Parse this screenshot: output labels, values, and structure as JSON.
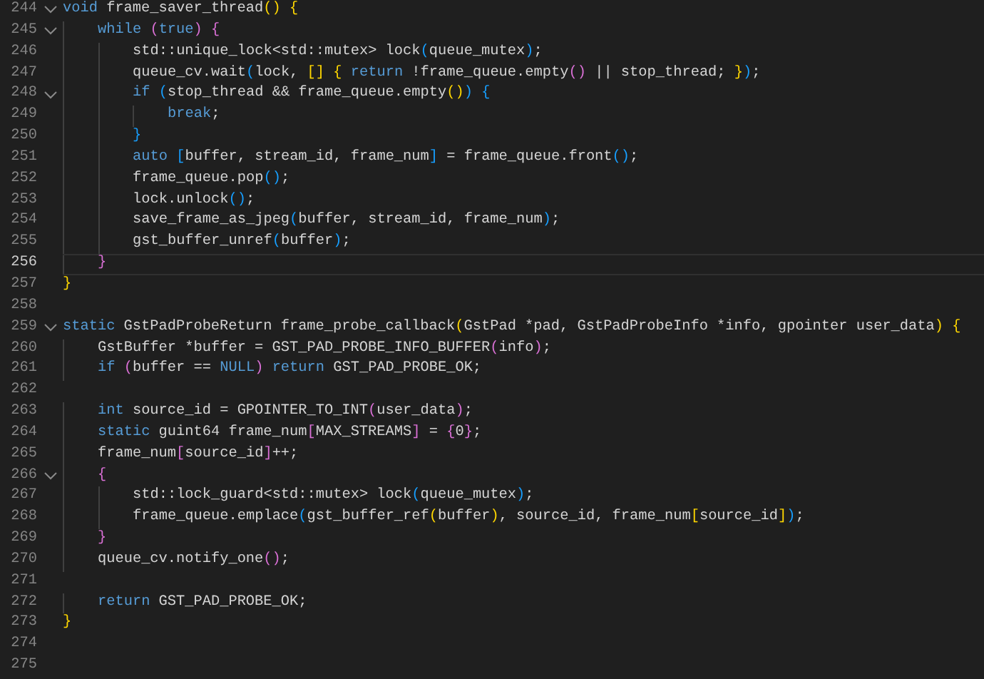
{
  "editor": {
    "lines": [
      {
        "number": "244",
        "fold": true,
        "selected": false,
        "tokens": [
          {
            "text": "void",
            "kind": "keyword"
          },
          {
            "text": " frame_saver_thread",
            "kind": "plain"
          },
          {
            "text": "()",
            "kind": "bracket1"
          },
          {
            "text": " {",
            "kind": "bracket1"
          }
        ]
      },
      {
        "number": "245",
        "fold": true,
        "selected": false,
        "tokens": [
          {
            "text": "    while",
            "kind": "keyword"
          },
          {
            "text": " (",
            "kind": "bracket2"
          },
          {
            "text": "true",
            "kind": "keyword"
          },
          {
            "text": ")",
            "kind": "bracket2"
          },
          {
            "text": " {",
            "kind": "bracket2"
          }
        ]
      },
      {
        "number": "246",
        "fold": false,
        "selected": false,
        "tokens": [
          {
            "text": "        std::unique_lock<std::mutex> lock",
            "kind": "plain"
          },
          {
            "text": "(",
            "kind": "bracket3"
          },
          {
            "text": "queue_mutex",
            "kind": "plain"
          },
          {
            "text": ")",
            "kind": "bracket3"
          },
          {
            "text": ";",
            "kind": "plain"
          }
        ]
      },
      {
        "number": "247",
        "fold": false,
        "selected": false,
        "tokens": [
          {
            "text": "        queue_cv.wait",
            "kind": "plain"
          },
          {
            "text": "(",
            "kind": "bracket3"
          },
          {
            "text": "lock, ",
            "kind": "plain"
          },
          {
            "text": "[]",
            "kind": "bracket1"
          },
          {
            "text": " {",
            "kind": "bracket1"
          },
          {
            "text": " return",
            "kind": "keyword"
          },
          {
            "text": " !frame_queue.empty",
            "kind": "plain"
          },
          {
            "text": "()",
            "kind": "bracket2"
          },
          {
            "text": " || stop_thread; ",
            "kind": "plain"
          },
          {
            "text": "}",
            "kind": "bracket1"
          },
          {
            "text": ")",
            "kind": "bracket3"
          },
          {
            "text": ";",
            "kind": "plain"
          }
        ]
      },
      {
        "number": "248",
        "fold": true,
        "selected": false,
        "tokens": [
          {
            "text": "        if",
            "kind": "keyword"
          },
          {
            "text": " (",
            "kind": "bracket3"
          },
          {
            "text": "stop_thread && frame_queue.empty",
            "kind": "plain"
          },
          {
            "text": "()",
            "kind": "bracket1"
          },
          {
            "text": ")",
            "kind": "bracket3"
          },
          {
            "text": " {",
            "kind": "bracket3"
          }
        ]
      },
      {
        "number": "249",
        "fold": false,
        "selected": false,
        "tokens": [
          {
            "text": "            break",
            "kind": "keyword"
          },
          {
            "text": ";",
            "kind": "plain"
          }
        ]
      },
      {
        "number": "250",
        "fold": false,
        "selected": false,
        "tokens": [
          {
            "text": "        }",
            "kind": "bracket3"
          }
        ]
      },
      {
        "number": "251",
        "fold": false,
        "selected": false,
        "tokens": [
          {
            "text": "        auto",
            "kind": "keyword"
          },
          {
            "text": " [",
            "kind": "bracket3"
          },
          {
            "text": "buffer, stream_id, frame_num",
            "kind": "plain"
          },
          {
            "text": "]",
            "kind": "bracket3"
          },
          {
            "text": " = frame_queue.front",
            "kind": "plain"
          },
          {
            "text": "()",
            "kind": "bracket3"
          },
          {
            "text": ";",
            "kind": "plain"
          }
        ]
      },
      {
        "number": "252",
        "fold": false,
        "selected": false,
        "tokens": [
          {
            "text": "        frame_queue.pop",
            "kind": "plain"
          },
          {
            "text": "()",
            "kind": "bracket3"
          },
          {
            "text": ";",
            "kind": "plain"
          }
        ]
      },
      {
        "number": "253",
        "fold": false,
        "selected": false,
        "tokens": [
          {
            "text": "        lock.unlock",
            "kind": "plain"
          },
          {
            "text": "()",
            "kind": "bracket3"
          },
          {
            "text": ";",
            "kind": "plain"
          }
        ]
      },
      {
        "number": "254",
        "fold": false,
        "selected": false,
        "tokens": [
          {
            "text": "        save_frame_as_jpeg",
            "kind": "plain"
          },
          {
            "text": "(",
            "kind": "bracket3"
          },
          {
            "text": "buffer, stream_id, frame_num",
            "kind": "plain"
          },
          {
            "text": ")",
            "kind": "bracket3"
          },
          {
            "text": ";",
            "kind": "plain"
          }
        ]
      },
      {
        "number": "255",
        "fold": false,
        "selected": false,
        "tokens": [
          {
            "text": "        gst_buffer_unref",
            "kind": "plain"
          },
          {
            "text": "(",
            "kind": "bracket3"
          },
          {
            "text": "buffer",
            "kind": "plain"
          },
          {
            "text": ")",
            "kind": "bracket3"
          },
          {
            "text": ";",
            "kind": "plain"
          }
        ]
      },
      {
        "number": "256",
        "fold": false,
        "selected": true,
        "tokens": [
          {
            "text": "    }",
            "kind": "bracket2"
          }
        ]
      },
      {
        "number": "257",
        "fold": false,
        "selected": false,
        "tokens": [
          {
            "text": "}",
            "kind": "bracket1"
          }
        ]
      },
      {
        "number": "258",
        "fold": false,
        "selected": false
      },
      {
        "number": "259",
        "fold": true,
        "selected": false,
        "tokens": [
          {
            "text": "static",
            "kind": "keyword"
          },
          {
            "text": " GstPadProbeReturn frame_probe_callback",
            "kind": "plain"
          },
          {
            "text": "(",
            "kind": "bracket1"
          },
          {
            "text": "GstPad *pad, GstPadProbeInfo *info, gpointer user_data",
            "kind": "plain"
          },
          {
            "text": ")",
            "kind": "bracket1"
          },
          {
            "text": " {",
            "kind": "bracket1"
          }
        ]
      },
      {
        "number": "260",
        "fold": false,
        "selected": false,
        "tokens": [
          {
            "text": "    GstBuffer *buffer = GST_PAD_PROBE_INFO_BUFFER",
            "kind": "plain"
          },
          {
            "text": "(",
            "kind": "bracket2"
          },
          {
            "text": "info",
            "kind": "plain"
          },
          {
            "text": ")",
            "kind": "bracket2"
          },
          {
            "text": ";",
            "kind": "plain"
          }
        ]
      },
      {
        "number": "261",
        "fold": false,
        "selected": false,
        "tokens": [
          {
            "text": "    if",
            "kind": "keyword"
          },
          {
            "text": " (",
            "kind": "bracket2"
          },
          {
            "text": "buffer == ",
            "kind": "plain"
          },
          {
            "text": "NULL",
            "kind": "keyword"
          },
          {
            "text": ")",
            "kind": "bracket2"
          },
          {
            "text": " return",
            "kind": "keyword"
          },
          {
            "text": " GST_PAD_PROBE_OK;",
            "kind": "plain"
          }
        ]
      },
      {
        "number": "262",
        "fold": false,
        "selected": false
      },
      {
        "number": "263",
        "fold": false,
        "selected": false,
        "tokens": [
          {
            "text": "    int",
            "kind": "keyword"
          },
          {
            "text": " source_id = GPOINTER_TO_INT",
            "kind": "plain"
          },
          {
            "text": "(",
            "kind": "bracket2"
          },
          {
            "text": "user_data",
            "kind": "plain"
          },
          {
            "text": ")",
            "kind": "bracket2"
          },
          {
            "text": ";",
            "kind": "plain"
          }
        ]
      },
      {
        "number": "264",
        "fold": false,
        "selected": false,
        "tokens": [
          {
            "text": "    static",
            "kind": "keyword"
          },
          {
            "text": " guint64 frame_num",
            "kind": "plain"
          },
          {
            "text": "[",
            "kind": "bracket2"
          },
          {
            "text": "MAX_STREAMS",
            "kind": "plain"
          },
          {
            "text": "]",
            "kind": "bracket2"
          },
          {
            "text": " = ",
            "kind": "plain"
          },
          {
            "text": "{",
            "kind": "bracket2"
          },
          {
            "text": "0",
            "kind": "plain"
          },
          {
            "text": "}",
            "kind": "bracket2"
          },
          {
            "text": ";",
            "kind": "plain"
          }
        ]
      },
      {
        "number": "265",
        "fold": false,
        "selected": false,
        "tokens": [
          {
            "text": "    frame_num",
            "kind": "plain"
          },
          {
            "text": "[",
            "kind": "bracket2"
          },
          {
            "text": "source_id",
            "kind": "plain"
          },
          {
            "text": "]",
            "kind": "bracket2"
          },
          {
            "text": "++;",
            "kind": "plain"
          }
        ]
      },
      {
        "number": "266",
        "fold": true,
        "selected": false,
        "tokens": [
          {
            "text": "    {",
            "kind": "bracket2"
          }
        ]
      },
      {
        "number": "267",
        "fold": false,
        "selected": false,
        "tokens": [
          {
            "text": "        std::lock_guard<std::mutex> lock",
            "kind": "plain"
          },
          {
            "text": "(",
            "kind": "bracket3"
          },
          {
            "text": "queue_mutex",
            "kind": "plain"
          },
          {
            "text": ")",
            "kind": "bracket3"
          },
          {
            "text": ";",
            "kind": "plain"
          }
        ]
      },
      {
        "number": "268",
        "fold": false,
        "selected": false,
        "tokens": [
          {
            "text": "        frame_queue.emplace",
            "kind": "plain"
          },
          {
            "text": "(",
            "kind": "bracket3"
          },
          {
            "text": "gst_buffer_ref",
            "kind": "plain"
          },
          {
            "text": "(",
            "kind": "bracket1"
          },
          {
            "text": "buffer",
            "kind": "plain"
          },
          {
            "text": ")",
            "kind": "bracket1"
          },
          {
            "text": ", source_id, frame_num",
            "kind": "plain"
          },
          {
            "text": "[",
            "kind": "bracket1"
          },
          {
            "text": "source_id",
            "kind": "plain"
          },
          {
            "text": "]",
            "kind": "bracket1"
          },
          {
            "text": ")",
            "kind": "bracket3"
          },
          {
            "text": ";",
            "kind": "plain"
          }
        ]
      },
      {
        "number": "269",
        "fold": false,
        "selected": false,
        "tokens": [
          {
            "text": "    }",
            "kind": "bracket2"
          }
        ]
      },
      {
        "number": "270",
        "fold": false,
        "selected": false,
        "tokens": [
          {
            "text": "    queue_cv.notify_one",
            "kind": "plain"
          },
          {
            "text": "()",
            "kind": "bracket2"
          },
          {
            "text": ";",
            "kind": "plain"
          }
        ]
      },
      {
        "number": "271",
        "fold": false,
        "selected": false
      },
      {
        "number": "272",
        "fold": false,
        "selected": false,
        "tokens": [
          {
            "text": "    return",
            "kind": "keyword"
          },
          {
            "text": " GST_PAD_PROBE_OK;",
            "kind": "plain"
          }
        ]
      },
      {
        "number": "273",
        "fold": false,
        "selected": false,
        "tokens": [
          {
            "text": "}",
            "kind": "bracket1"
          }
        ]
      },
      {
        "number": "274",
        "fold": false,
        "selected": false
      },
      {
        "number": "275",
        "fold": false,
        "selected": false
      }
    ]
  }
}
